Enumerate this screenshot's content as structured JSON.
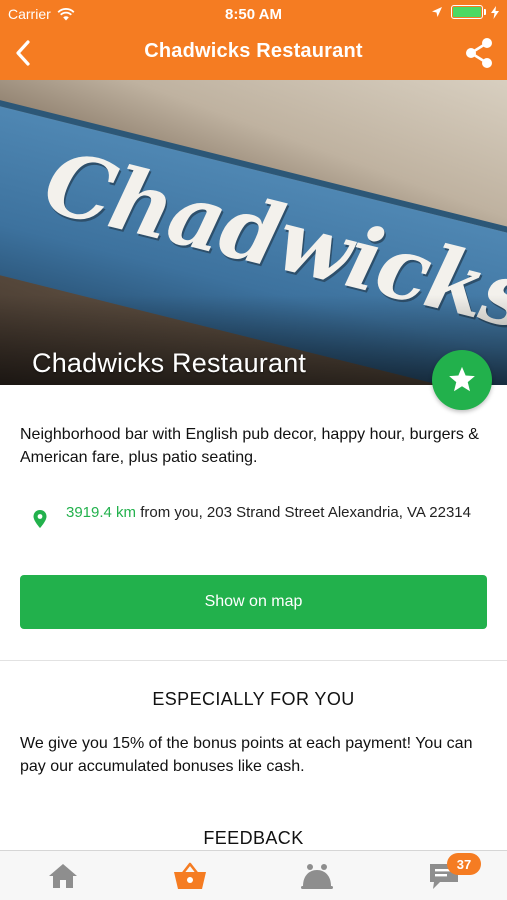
{
  "status_bar": {
    "carrier": "Carrier",
    "time": "8:50 AM",
    "icons": [
      "wifi-icon",
      "location-arrow-icon",
      "battery-icon",
      "charging-bolt-icon"
    ]
  },
  "nav": {
    "title": "Chadwicks Restaurant",
    "back_icon": "chevron-left-icon",
    "share_icon": "share-icon"
  },
  "hero": {
    "awning_text": "Chadwicks",
    "name": "Chadwicks Restaurant",
    "favorite_icon": "star-icon"
  },
  "details": {
    "description": "Neighborhood bar with English pub decor, happy hour, burgers & American fare, plus patio seating.",
    "distance": "3919.4 km",
    "address_rest": " from you, 203 Strand Street Alexandria, VA 22314",
    "map_button": "Show on map"
  },
  "especially": {
    "title": "ESPECIALLY FOR YOU",
    "text": "We give you 15% of the bonus points at each payment! You can pay our accumulated bonuses like cash."
  },
  "feedback": {
    "title": "FEEDBACK"
  },
  "tabbar": {
    "items": [
      {
        "icon": "home-icon",
        "active": false
      },
      {
        "icon": "basket-icon",
        "active": true
      },
      {
        "icon": "cloche-icon",
        "active": false
      },
      {
        "icon": "chat-icon",
        "active": false,
        "badge": "37"
      }
    ]
  },
  "colors": {
    "brand_orange": "#f57c22",
    "accent_green": "#22b14c",
    "tab_inactive": "#8e8e8e"
  }
}
